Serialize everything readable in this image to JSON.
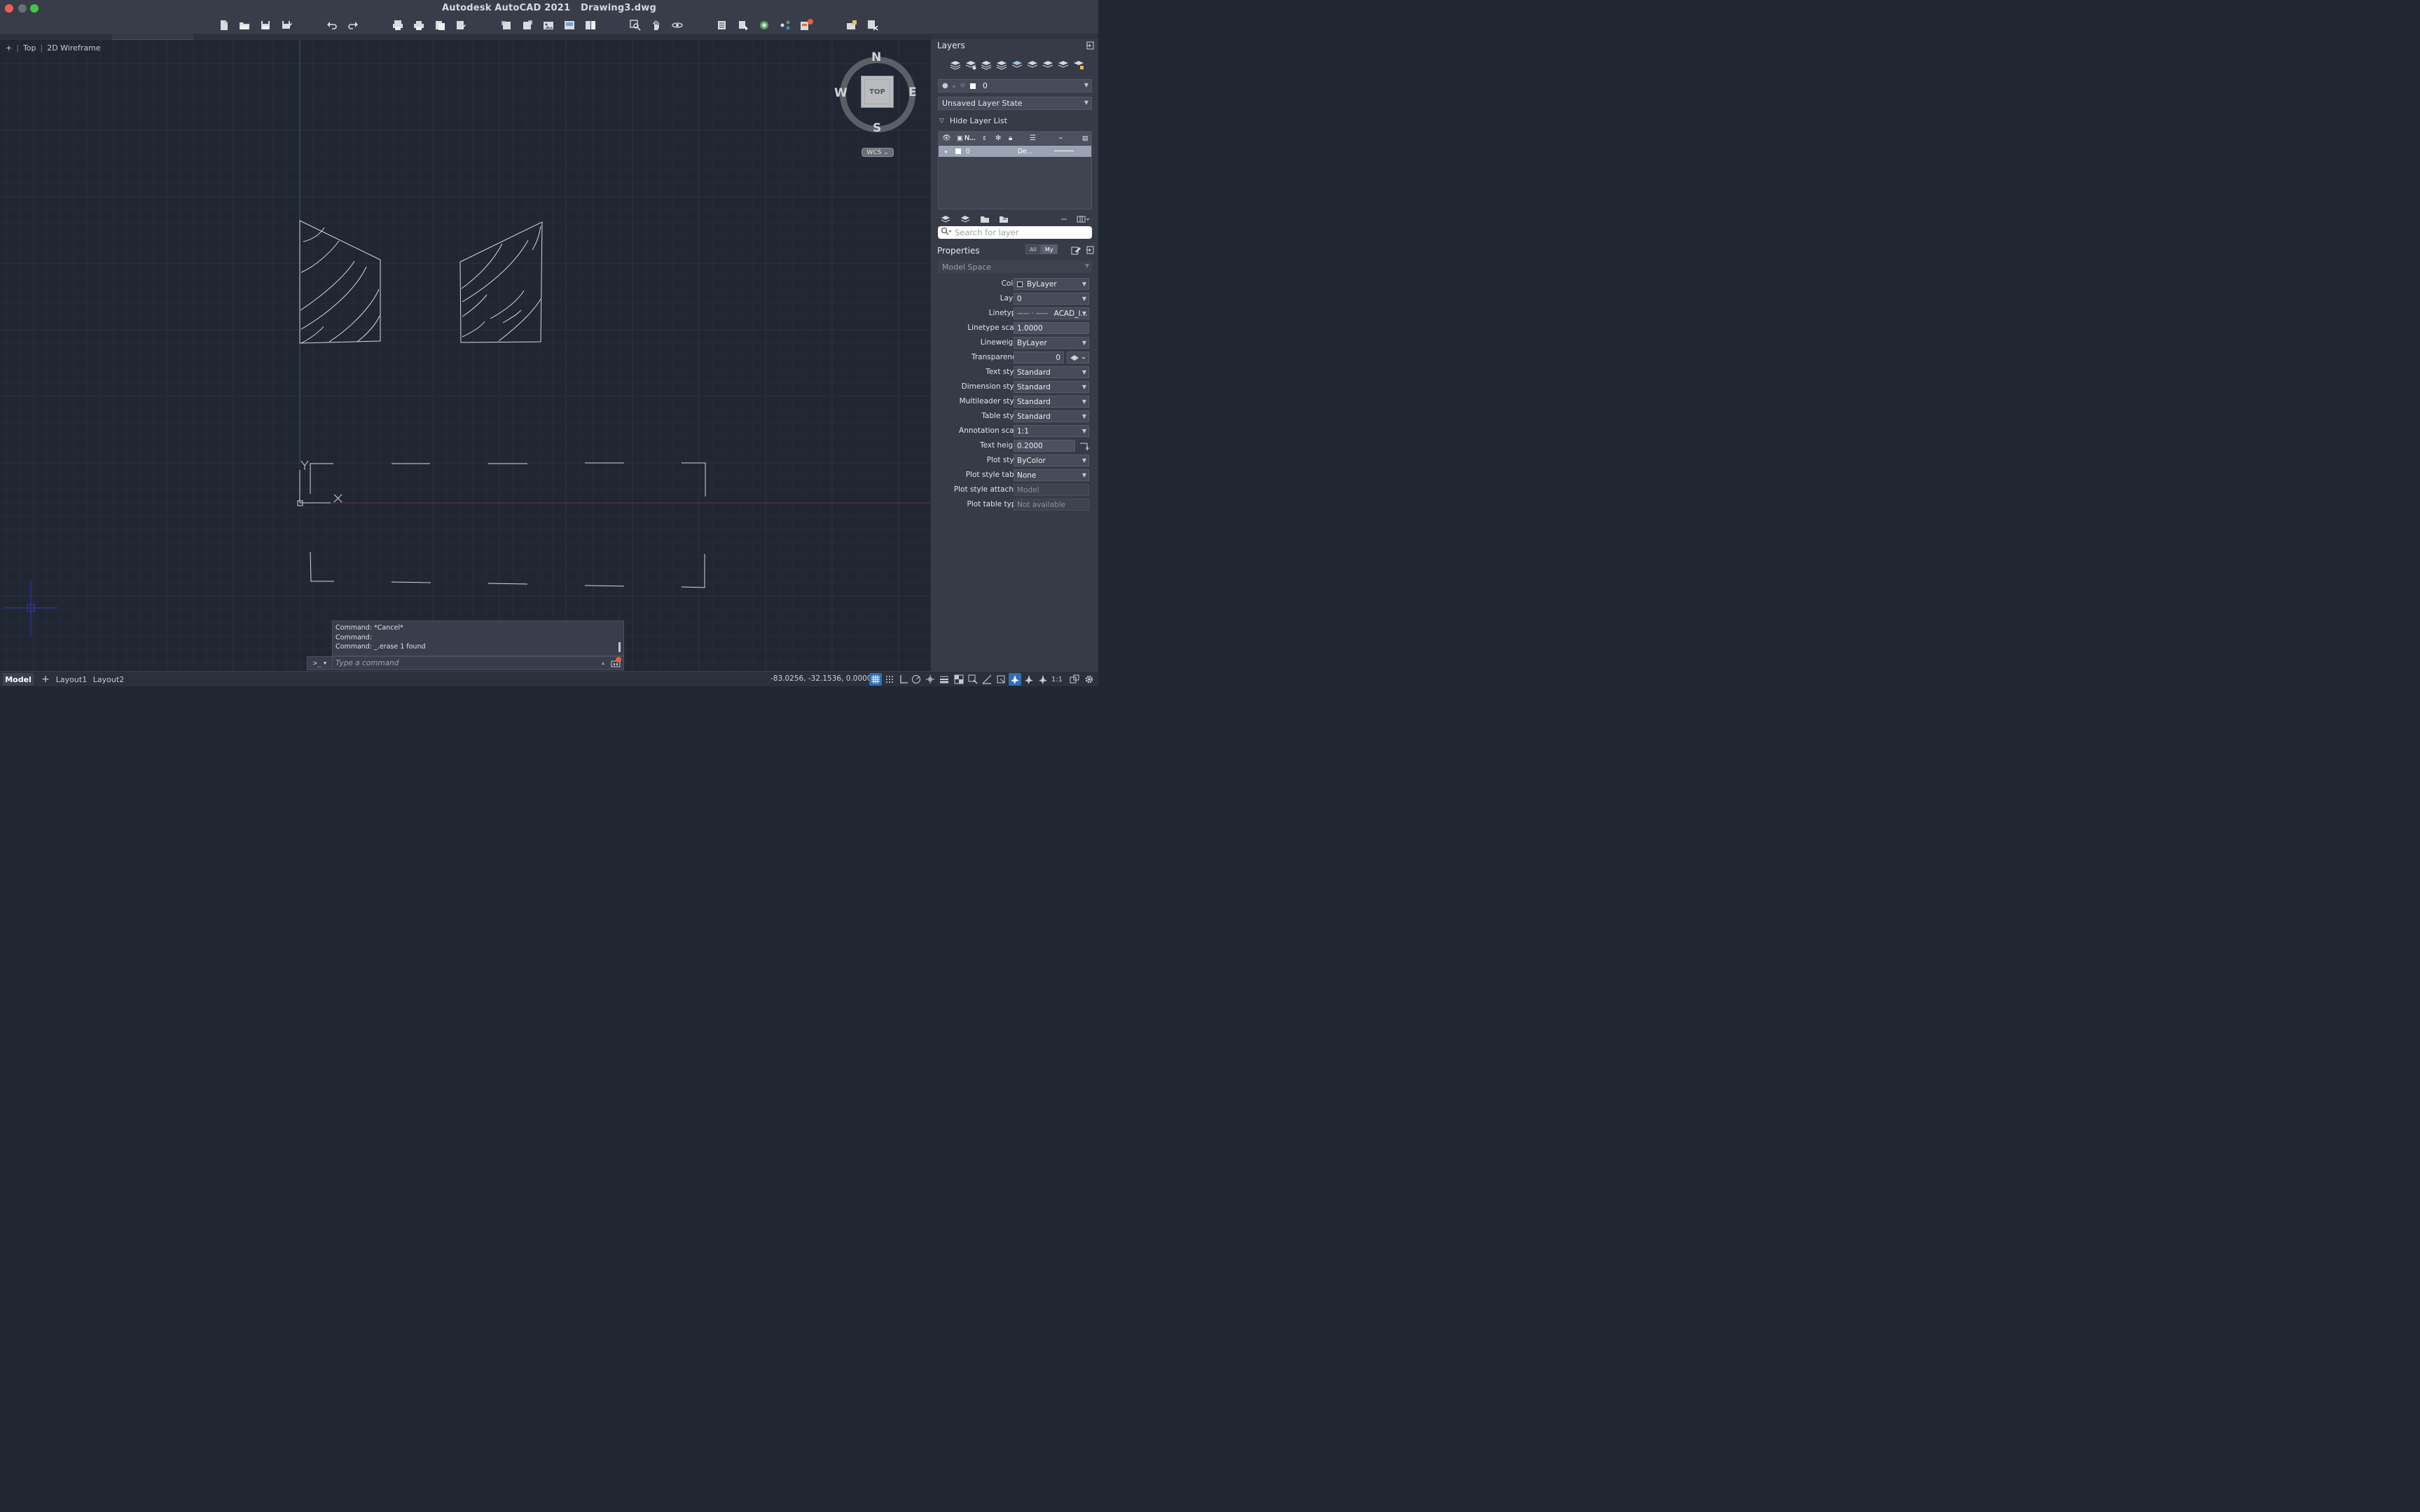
{
  "window": {
    "app_title": "Autodesk AutoCAD 2021",
    "document": "Drawing3.dwg"
  },
  "toolbar": {
    "icons": [
      "new-icon",
      "open-icon",
      "save-icon",
      "save-as-icon",
      "undo-icon",
      "redo-icon",
      "plot-icon",
      "batch-plot-icon",
      "page-setup-icon",
      "publish-icon",
      "import-icon",
      "export-icon",
      "attach-icon",
      "xref-icon",
      "insert-block-icon",
      "zoom-icon",
      "pan-icon",
      "orbit-icon",
      "layer-properties-icon",
      "match-layer-icon",
      "geolocation-icon",
      "share-icon",
      "notifications-icon",
      "snapshot-icon",
      "render-icon"
    ]
  },
  "viewport": {
    "plus": "+",
    "view": "Top",
    "style": "2D Wireframe"
  },
  "viewcube": {
    "top_face": "TOP",
    "n": "N",
    "s": "S",
    "e": "E",
    "w": "W",
    "wcs": "WCS"
  },
  "command_line": {
    "history": [
      "Command: *Cancel*",
      "Command:",
      "Command: _.erase 1 found"
    ],
    "prompt_symbol": ">_",
    "placeholder": "Type a command"
  },
  "status_bar": {
    "tabs": [
      "Model",
      "Layout1",
      "Layout2"
    ],
    "add_tab": "+",
    "coordinates": "-83.0256, -32.1536, 0.0000",
    "scale": "1:1"
  },
  "layers_panel": {
    "title": "Layers",
    "current_layer": "0",
    "layer_state": "Unsaved Layer State",
    "hide_layer_list": "Hide Layer List",
    "column_name": "N...",
    "rows": [
      {
        "name": "0",
        "linetype": "De..."
      }
    ],
    "search_placeholder": "Search for layer"
  },
  "properties_panel": {
    "title": "Properties",
    "filter_all": "All",
    "filter_my": "My",
    "scope": "Model Space",
    "rows": [
      {
        "label": "Color",
        "value": "ByLayer"
      },
      {
        "label": "Layer",
        "value": "0"
      },
      {
        "label": "Linetype",
        "value": "ACAD_I..."
      },
      {
        "label": "Linetype scale",
        "value": "1.0000"
      },
      {
        "label": "Lineweight",
        "value": "ByLayer"
      },
      {
        "label": "Transparency",
        "value": "0"
      },
      {
        "label": "Text style",
        "value": "Standard"
      },
      {
        "label": "Dimension style",
        "value": "Standard"
      },
      {
        "label": "Multileader style",
        "value": "Standard"
      },
      {
        "label": "Table style",
        "value": "Standard"
      },
      {
        "label": "Annotation scale",
        "value": "1:1"
      },
      {
        "label": "Text height",
        "value": "0.2000"
      },
      {
        "label": "Plot style",
        "value": "ByColor"
      },
      {
        "label": "Plot style table",
        "value": "None"
      },
      {
        "label": "Plot style attach...",
        "value": "Model"
      },
      {
        "label": "Plot table type",
        "value": "Not available"
      }
    ]
  },
  "colors": {
    "canvas": "#212633",
    "grid_minor": "#272c39",
    "grid_major": "#2d3240",
    "drawing_lines": "#d4d7dd",
    "accent": "#2f6fb5",
    "selected_layer_row": "#9aa3b3"
  }
}
